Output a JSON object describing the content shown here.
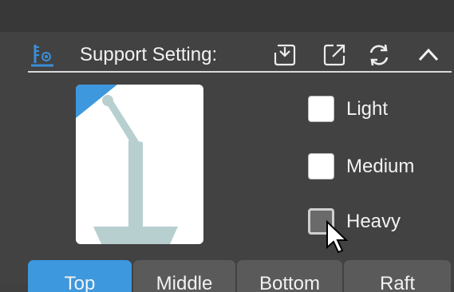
{
  "section": {
    "title": "Support Setting:",
    "tools": [
      {
        "name": "import-icon"
      },
      {
        "name": "export-icon"
      },
      {
        "name": "refresh-icon"
      },
      {
        "name": "collapse-icon"
      }
    ]
  },
  "options": [
    {
      "label": "Light",
      "checked": false
    },
    {
      "label": "Medium",
      "checked": false
    },
    {
      "label": "Heavy",
      "checked": false,
      "hovered": true
    }
  ],
  "tabs": [
    {
      "label": "Top",
      "active": true
    },
    {
      "label": "Middle",
      "active": false
    },
    {
      "label": "Bottom",
      "active": false
    },
    {
      "label": "Raft",
      "active": false
    }
  ],
  "colors": {
    "accent": "#3d98dd",
    "support": "#b8cfd0",
    "panel": "#424242"
  }
}
